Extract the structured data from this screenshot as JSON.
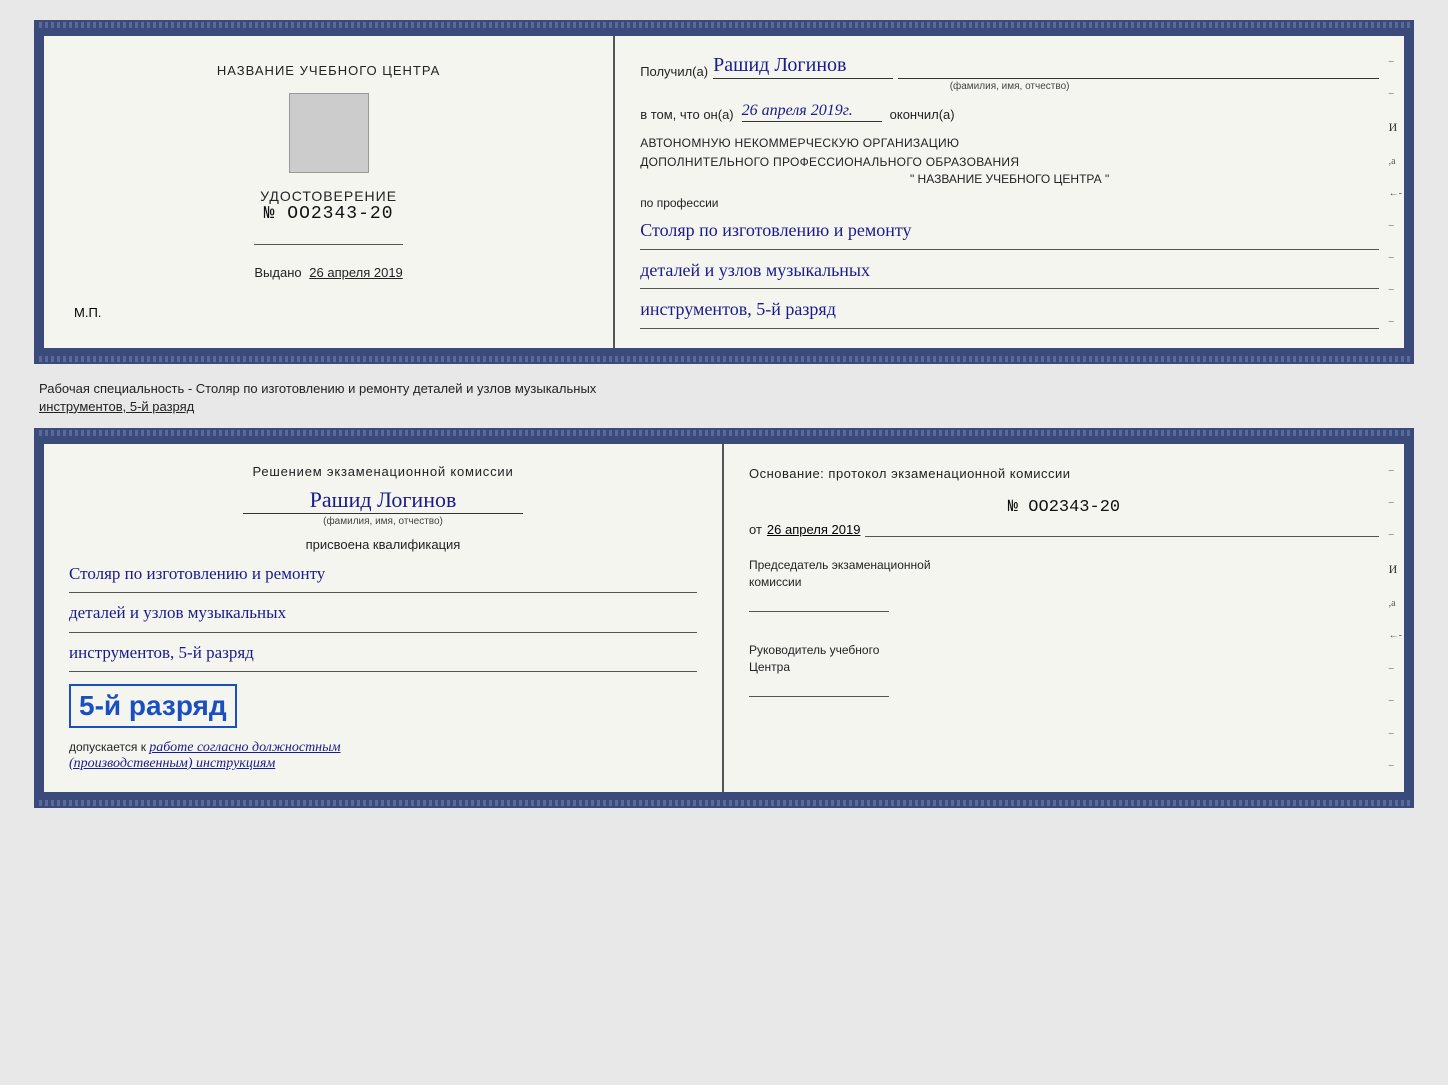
{
  "top_cert": {
    "left": {
      "center_title": "НАЗВАНИЕ УЧЕБНОГО ЦЕНТРА",
      "stamp_label": "stamp",
      "udost_title": "УДОСТОВЕРЕНИЕ",
      "udost_number": "№ OO2343-20",
      "vydano_label": "Выдано",
      "vydano_date": "26 апреля 2019",
      "mp_label": "М.П."
    },
    "right": {
      "poluchil_label": "Получил(а)",
      "recipient_name": "Рашид Логинов",
      "fio_subtitle": "(фамилия, имя, отчество)",
      "vtom_label": "в том, что он(а)",
      "date_handwritten": "26 апреля 2019г.",
      "okonchil_label": "окончил(а)",
      "org_line1": "АВТОНОМНУЮ НЕКОММЕРЧЕСКУЮ ОРГАНИЗАЦИЮ",
      "org_line2": "ДОПОЛНИТЕЛЬНОГО ПРОФЕССИОНАЛЬНОГО ОБРАЗОВАНИЯ",
      "org_name": "\"  НАЗВАНИЕ УЧЕБНОГО ЦЕНТРА  \"",
      "po_professii_label": "по профессии",
      "profession_line1": "Столяр по изготовлению и ремонту",
      "profession_line2": "деталей и узлов музыкальных",
      "profession_line3": "инструментов, 5-й разряд"
    }
  },
  "specialty_text": "Рабочая специальность - Столяр по изготовлению и ремонту деталей и узлов музыкальных",
  "specialty_text2": "инструментов, 5-й разряд",
  "bottom_cert": {
    "left": {
      "resheniem_label": "Решением экзаменационной комиссии",
      "recipient_name": "Рашид Логинов",
      "fio_subtitle": "(фамилия, имя, отчество)",
      "prisvoena_label": "присвоена квалификация",
      "profession_line1": "Столяр по изготовлению и ремонту",
      "profession_line2": "деталей и узлов музыкальных",
      "profession_line3": "инструментов, 5-й разряд",
      "rank_text": "5-й разряд",
      "dopuskaetsya_label": "допускается к",
      "work_text": "работе согласно должностным",
      "instruktsii_text": "(производственным) инструкциям"
    },
    "right": {
      "osnovanie_label": "Основание: протокол экзаменационной комиссии",
      "protocol_number": "№ OO2343-20",
      "ot_label": "от",
      "ot_date": "26 апреля 2019",
      "predsedatel_label": "Председатель экзаменационной",
      "predsedatel_label2": "комиссии",
      "rukovoditel_label": "Руководитель учебного",
      "rukovoditel_label2": "Центра"
    }
  }
}
